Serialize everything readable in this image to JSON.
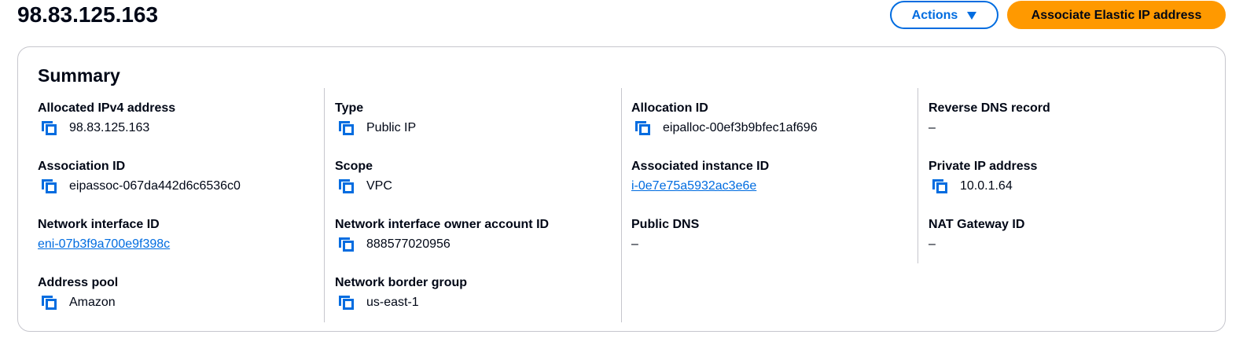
{
  "header": {
    "title": "98.83.125.163",
    "actions_label": "Actions",
    "associate_label": "Associate Elastic IP address"
  },
  "summary": {
    "title": "Summary",
    "columns": [
      {
        "fields": [
          {
            "label": "Allocated IPv4 address",
            "value": "98.83.125.163",
            "copy": true,
            "link": false
          },
          {
            "label": "Association ID",
            "value": "eipassoc-067da442d6c6536c0",
            "copy": true,
            "link": false
          },
          {
            "label": "Network interface ID",
            "value": "eni-07b3f9a700e9f398c",
            "copy": false,
            "link": true
          },
          {
            "label": "Address pool",
            "value": "Amazon",
            "copy": true,
            "link": false
          }
        ]
      },
      {
        "fields": [
          {
            "label": "Type",
            "value": "Public IP",
            "copy": true,
            "link": false
          },
          {
            "label": "Scope",
            "value": "VPC",
            "copy": true,
            "link": false
          },
          {
            "label": "Network interface owner account ID",
            "value": "888577020956",
            "copy": true,
            "link": false
          },
          {
            "label": "Network border group",
            "value": "us-east-1",
            "copy": true,
            "link": false
          }
        ]
      },
      {
        "fields": [
          {
            "label": "Allocation ID",
            "value": "eipalloc-00ef3b9bfec1af696",
            "copy": true,
            "link": false
          },
          {
            "label": "Associated instance ID",
            "value": "i-0e7e75a5932ac3e6e",
            "copy": false,
            "link": true
          },
          {
            "label": "Public DNS",
            "value": "–",
            "copy": false,
            "link": false
          }
        ]
      },
      {
        "fields": [
          {
            "label": "Reverse DNS record",
            "value": "–",
            "copy": false,
            "link": false
          },
          {
            "label": "Private IP address",
            "value": "10.0.1.64",
            "copy": true,
            "link": false
          },
          {
            "label": "NAT Gateway ID",
            "value": "–",
            "copy": false,
            "link": false
          }
        ]
      }
    ]
  },
  "icons": {
    "copy": "copy-icon",
    "dropdown": "caret-down-icon"
  },
  "colors": {
    "link": "#006ce0",
    "primary_button": "#ff9900",
    "border": "#c6c6cd",
    "text": "#000716"
  }
}
